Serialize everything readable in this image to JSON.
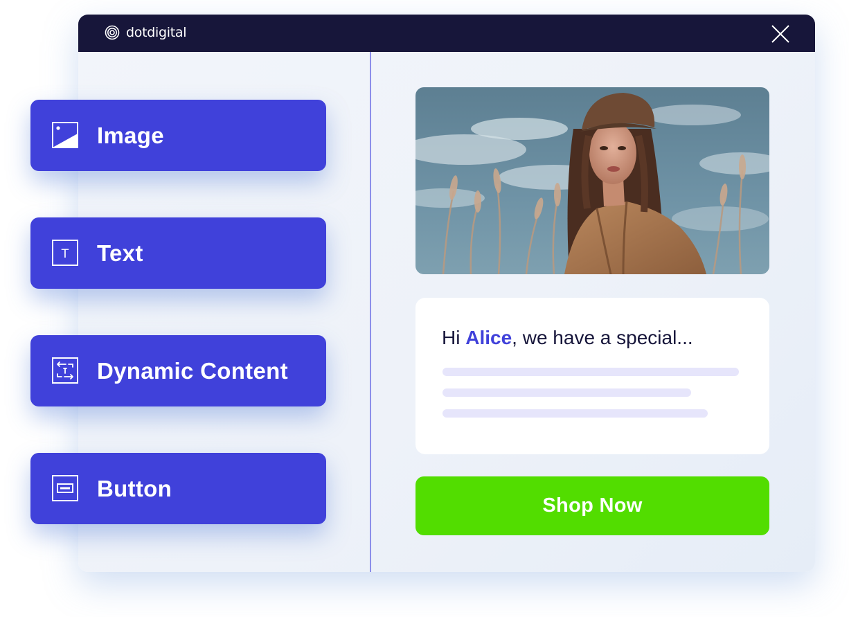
{
  "window": {
    "brand": "dotdigital",
    "close_icon": "close-icon"
  },
  "palette": {
    "items": [
      {
        "label": "Image",
        "icon": "image-icon"
      },
      {
        "label": "Text",
        "icon": "text-icon"
      },
      {
        "label": "Dynamic Content",
        "icon": "dynamic-content-icon"
      },
      {
        "label": "Button",
        "icon": "button-icon"
      }
    ],
    "text_icon_glyph": "T"
  },
  "preview": {
    "greeting_prefix": "Hi ",
    "greeting_name": "Alice",
    "greeting_suffix": ", we have a special...",
    "cta_label": "Shop Now"
  },
  "colors": {
    "titlebar": "#17163a",
    "block": "#4041da",
    "accent_name": "#4041da",
    "cta": "#52dd00",
    "placeholder_line": "#e6e5fb"
  }
}
